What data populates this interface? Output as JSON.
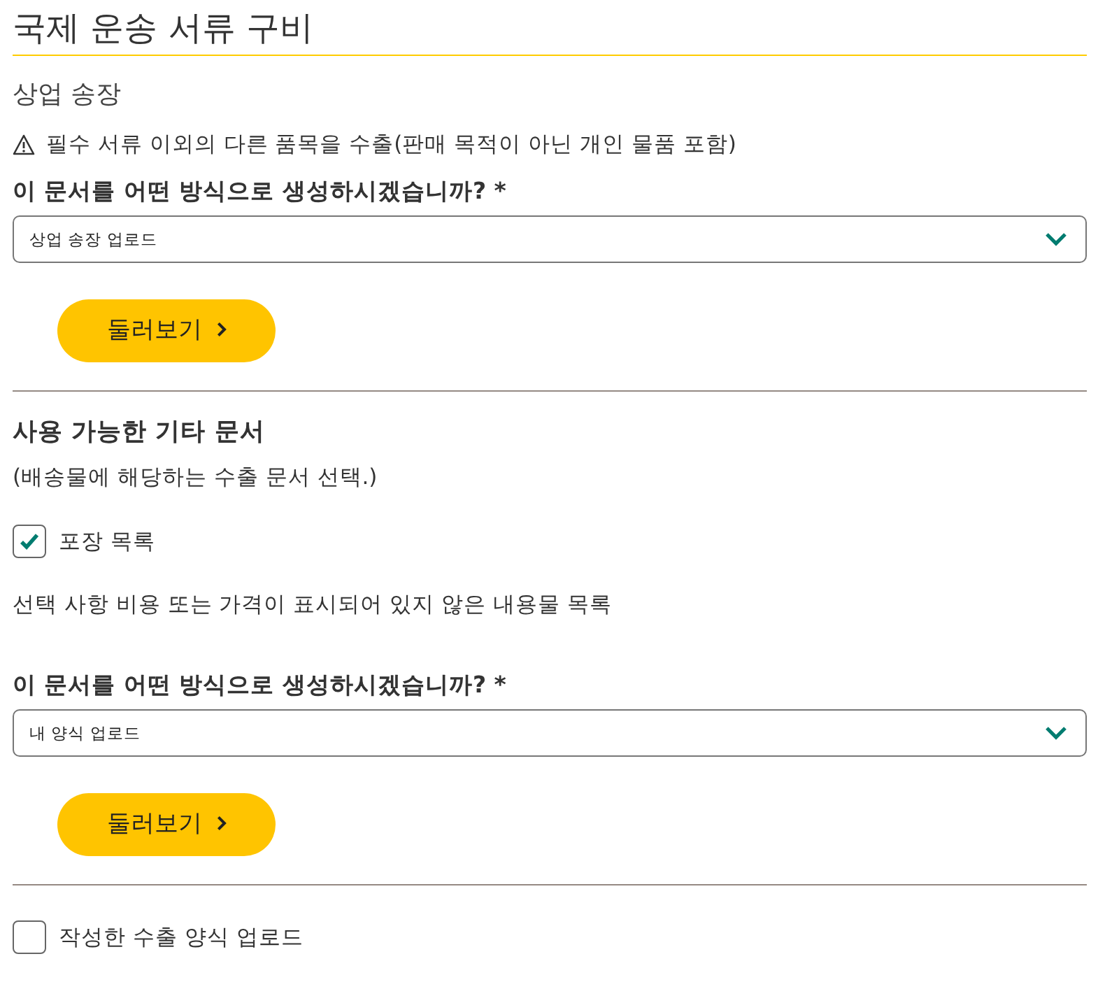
{
  "page": {
    "title": "국제 운송 서류 구비"
  },
  "commercial_invoice": {
    "heading": "상업 송장",
    "notice": "필수 서류 이외의 다른 품목을 수출(판매 목적이 아닌 개인 물품 포함)",
    "question": "이 문서를 어떤 방식으로 생성하시겠습니까? *",
    "select": {
      "value": "상업 송장 업로드"
    },
    "button": {
      "label": "둘러보기"
    }
  },
  "other_documents": {
    "heading": "사용 가능한 기타 문서",
    "hint": "(배송물에 해당하는 수출 문서 선택.)",
    "documents": [
      {
        "label": "포장 목록",
        "checked": true,
        "description": "선택 사항 비용 또는 가격이 표시되어 있지 않은 내용물 목록",
        "question": "이 문서를 어떤 방식으로 생성하시겠습니까? *",
        "select": {
          "value": "내 양식 업로드"
        },
        "button": {
          "label": "둘러보기"
        }
      }
    ]
  },
  "upload_own": {
    "label": "작성한 수출 양식 업로드",
    "checked": false
  }
}
